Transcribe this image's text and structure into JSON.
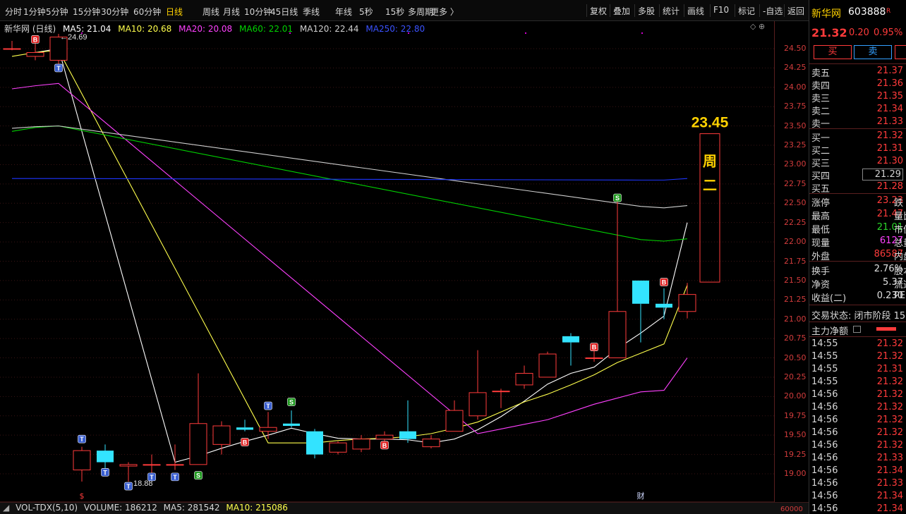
{
  "toolbar": {
    "timeframes": [
      "分时",
      "1分钟",
      "5分钟",
      "15分钟",
      "30分钟",
      "60分钟",
      "日线",
      "周线",
      "月线",
      "10分钟",
      "45日线",
      "季线",
      "年线",
      "5秒",
      "15秒",
      "多周期",
      "更多 〉"
    ],
    "active_timeframe": "日线",
    "buttons": [
      "复权",
      "叠加",
      "多股",
      "统计",
      "画线",
      "F10",
      "标记",
      "-自选",
      "返回"
    ]
  },
  "legend": {
    "title": "新华网 (日线)",
    "ma5": "MA5: 21.04",
    "ma10": "MA10: 20.68",
    "ma20": "MA20: 20.08",
    "ma60": "MA60: 22.01",
    "ma120": "MA120: 22.44",
    "ma250": "MA250: 22.80",
    "toolicons": "◇ ⊕"
  },
  "colors": {
    "up": "#ff3b3b",
    "down": "#33e3ff",
    "ma5": "#ffffff",
    "ma10": "#ffff4c",
    "ma20": "#ff40ff",
    "ma60": "#00d200",
    "ma120": "#cfcfcf",
    "ma250": "#1e36ff",
    "axis": "#d23c3c",
    "highlight": "#ffd200"
  },
  "chart_data": {
    "type": "candlestick",
    "title": "新华网 (日线)",
    "ylim": [
      18.7,
      24.75
    ],
    "y_ticks": [
      24.5,
      24.25,
      24.0,
      23.75,
      23.5,
      23.25,
      23.0,
      22.75,
      22.5,
      22.25,
      22.0,
      21.75,
      21.5,
      21.25,
      21.0,
      20.75,
      20.5,
      20.25,
      20.0,
      19.75,
      19.5,
      19.25,
      19.0
    ],
    "candles": [
      [
        24.5,
        24.5,
        24.6,
        24.48
      ],
      [
        24.4,
        24.45,
        24.6,
        24.35
      ],
      [
        24.35,
        24.65,
        24.69,
        24.3
      ],
      [
        19.05,
        19.3,
        19.35,
        18.9
      ],
      [
        19.3,
        19.15,
        19.38,
        19.05
      ],
      [
        19.1,
        19.12,
        19.15,
        18.9
      ],
      [
        19.12,
        19.12,
        19.25,
        19.0
      ],
      [
        19.12,
        19.12,
        19.38,
        19.05
      ],
      [
        19.12,
        19.65,
        20.3,
        19.12
      ],
      [
        19.38,
        19.62,
        19.68,
        19.25
      ],
      [
        19.6,
        19.57,
        19.7,
        19.55
      ],
      [
        19.55,
        19.6,
        19.8,
        19.45
      ],
      [
        19.65,
        19.62,
        19.82,
        19.6
      ],
      [
        19.55,
        19.25,
        19.58,
        19.2
      ],
      [
        19.28,
        19.4,
        19.42,
        19.25
      ],
      [
        19.32,
        19.45,
        19.5,
        19.28
      ],
      [
        19.45,
        19.5,
        19.55,
        19.4
      ],
      [
        19.55,
        19.45,
        19.95,
        19.4
      ],
      [
        19.35,
        19.45,
        19.5,
        19.33
      ],
      [
        19.55,
        19.82,
        19.95,
        19.55
      ],
      [
        19.75,
        20.05,
        20.6,
        19.7
      ],
      [
        20.07,
        20.07,
        20.1,
        19.85
      ],
      [
        20.15,
        20.3,
        20.4,
        20.1
      ],
      [
        20.25,
        20.55,
        20.58,
        20.25
      ],
      [
        20.78,
        20.7,
        20.82,
        20.4
      ],
      [
        20.5,
        20.5,
        20.6,
        20.45
      ],
      [
        20.5,
        21.1,
        22.55,
        20.5
      ],
      [
        21.5,
        21.2,
        21.5,
        20.7
      ],
      [
        21.2,
        21.15,
        21.4,
        21.0
      ],
      [
        21.1,
        21.32,
        21.47,
        21.01
      ]
    ],
    "series": [
      {
        "name": "MA5",
        "values": [
          null,
          24.45,
          24.5,
          null,
          null,
          null,
          null,
          19.15,
          19.23,
          19.33,
          19.42,
          19.5,
          19.59,
          19.52,
          19.46,
          19.45,
          19.45,
          19.44,
          19.4,
          19.45,
          19.57,
          19.74,
          19.94,
          20.16,
          20.3,
          20.38,
          20.62,
          20.82,
          21.04,
          22.25
        ]
      },
      {
        "name": "MA10",
        "values": [
          24.4,
          24.45,
          24.48,
          null,
          null,
          null,
          null,
          null,
          null,
          null,
          null,
          19.4,
          19.4,
          19.4,
          19.43,
          19.45,
          19.46,
          19.48,
          19.52,
          19.59,
          19.67,
          19.8,
          19.93,
          20.03,
          20.15,
          20.28,
          20.44,
          20.56,
          20.68,
          21.44
        ]
      },
      {
        "name": "MA20",
        "values": [
          23.98,
          24.02,
          24.05,
          null,
          null,
          null,
          null,
          null,
          null,
          null,
          null,
          null,
          null,
          null,
          null,
          null,
          null,
          null,
          null,
          null,
          19.52,
          19.58,
          19.64,
          19.7,
          19.8,
          19.9,
          19.98,
          20.06,
          20.08,
          20.5
        ]
      },
      {
        "name": "MA60",
        "values": [
          23.43,
          23.48,
          23.5,
          null,
          null,
          null,
          null,
          null,
          null,
          null,
          null,
          null,
          null,
          null,
          null,
          null,
          null,
          null,
          null,
          null,
          null,
          null,
          null,
          null,
          null,
          null,
          null,
          22.03,
          22.01,
          22.04
        ]
      },
      {
        "name": "MA120",
        "values": [
          23.47,
          23.49,
          23.5,
          null,
          null,
          null,
          null,
          null,
          null,
          null,
          null,
          null,
          null,
          null,
          null,
          null,
          null,
          null,
          null,
          null,
          null,
          null,
          null,
          null,
          null,
          null,
          null,
          22.46,
          22.44,
          22.47
        ]
      },
      {
        "name": "MA250",
        "values": [
          22.82,
          22.82,
          22.82,
          null,
          null,
          null,
          null,
          null,
          null,
          null,
          null,
          null,
          null,
          null,
          null,
          null,
          null,
          null,
          null,
          null,
          null,
          null,
          null,
          null,
          null,
          null,
          null,
          22.8,
          22.8,
          22.82
        ]
      }
    ],
    "projection_box": {
      "top": 23.4,
      "bottom": 21.48,
      "label": "23.45",
      "text": "周二"
    },
    "annotations": {
      "high": "24.69",
      "low": "18.88"
    },
    "markers": [
      {
        "i": 1,
        "v": 24.62,
        "t": "B"
      },
      {
        "i": 2,
        "v": 24.25,
        "t": "T"
      },
      {
        "i": 3,
        "v": 19.45,
        "t": "T"
      },
      {
        "i": 4,
        "v": 19.02,
        "t": "T"
      },
      {
        "i": 5,
        "v": 18.84,
        "t": "T"
      },
      {
        "i": 6,
        "v": 18.96,
        "t": "T"
      },
      {
        "i": 7,
        "v": 18.96,
        "t": "T"
      },
      {
        "i": 8,
        "v": 18.98,
        "t": "S"
      },
      {
        "i": 10,
        "v": 19.41,
        "t": "B"
      },
      {
        "i": 11,
        "v": 19.88,
        "t": "T"
      },
      {
        "i": 12,
        "v": 19.93,
        "t": "S"
      },
      {
        "i": 16,
        "v": 19.37,
        "t": "B"
      },
      {
        "i": 17,
        "v": 20.03,
        "t": "■"
      },
      {
        "i": 25,
        "v": 20.64,
        "t": "B"
      },
      {
        "i": 26,
        "v": 22.57,
        "t": "S"
      },
      {
        "i": 28,
        "v": 21.48,
        "t": "B"
      }
    ],
    "bottom_marks": [
      {
        "i": 3,
        "t": "$"
      },
      {
        "i": 27,
        "t": "财"
      }
    ],
    "volume": {
      "label": "VOL-TDX(5,10)",
      "volume": "VOLUME: 186212",
      "ma5": "MA5: 281542",
      "ma10": "MA10: 215086",
      "axis_label": "60000"
    }
  },
  "panel": {
    "name": "新华网",
    "code": "603888",
    "badge": "R",
    "price": "21.32",
    "change": "0.20",
    "pct": "0.95%",
    "buy": "买",
    "sell": "卖",
    "asks": [
      {
        "k": "卖五",
        "v": "21.37"
      },
      {
        "k": "卖四",
        "v": "21.36"
      },
      {
        "k": "卖三",
        "v": "21.35"
      },
      {
        "k": "卖二",
        "v": "21.34"
      },
      {
        "k": "卖一",
        "v": "21.33"
      }
    ],
    "bids": [
      {
        "k": "买一",
        "v": "21.32"
      },
      {
        "k": "买二",
        "v": "21.31"
      },
      {
        "k": "买三",
        "v": "21.30"
      },
      {
        "k": "买四",
        "v": "21.29"
      },
      {
        "k": "买五",
        "v": "21.28"
      }
    ],
    "stats": [
      {
        "k": "涨停",
        "v": "23.23",
        "k2": "跌"
      },
      {
        "k": "最高",
        "v": "21.47",
        "k2": "量比"
      },
      {
        "k": "最低",
        "v": "21.01",
        "k2": "市值"
      },
      {
        "k": "现量",
        "v": "6127",
        "k2": "总量"
      },
      {
        "k": "外盘",
        "v": "86587",
        "k2": "内盘"
      }
    ],
    "stats2": [
      {
        "k": "换手",
        "v": "2.76%",
        "k2": "股本"
      },
      {
        "k": "净资",
        "v": "5.37",
        "k2": "流通"
      },
      {
        "k": "收益(二)",
        "v": "0.230",
        "k2": "PE"
      }
    ],
    "status": "交易状态: 闭市阶段 15",
    "flow_label": "主力净额",
    "ticks": [
      {
        "t": "14:55",
        "p": "21.32"
      },
      {
        "t": "14:55",
        "p": "21.32"
      },
      {
        "t": "14:55",
        "p": "21.31"
      },
      {
        "t": "14:55",
        "p": "21.32"
      },
      {
        "t": "14:56",
        "p": "21.32"
      },
      {
        "t": "14:56",
        "p": "21.32"
      },
      {
        "t": "14:56",
        "p": "21.32"
      },
      {
        "t": "14:56",
        "p": "21.32"
      },
      {
        "t": "14:56",
        "p": "21.32"
      },
      {
        "t": "14:56",
        "p": "21.33"
      },
      {
        "t": "14:56",
        "p": "21.34"
      },
      {
        "t": "14:56",
        "p": "21.33"
      },
      {
        "t": "14:56",
        "p": "21.34"
      },
      {
        "t": "14:56",
        "p": "21.34"
      }
    ]
  }
}
